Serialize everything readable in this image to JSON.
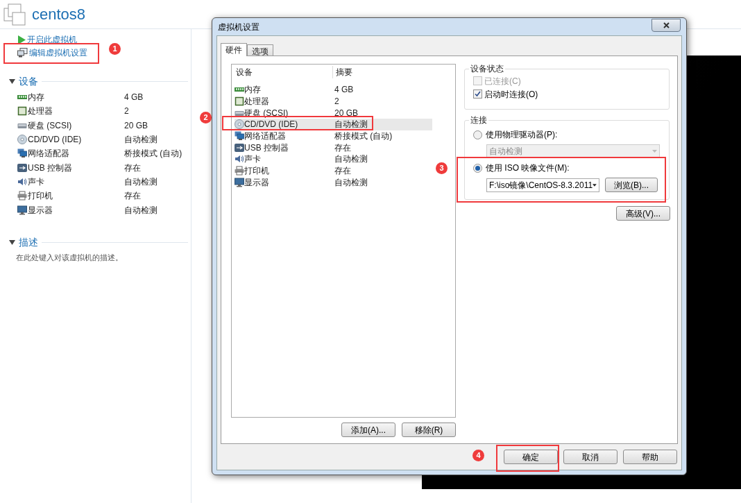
{
  "vm_title": "centos8",
  "actions": [
    {
      "label": "开启此虚拟机",
      "kind": "play"
    },
    {
      "label": "编辑虚拟机设置",
      "kind": "edit"
    }
  ],
  "devices_section": {
    "title": "设备",
    "expanded": true,
    "items": [
      {
        "name": "内存",
        "value": "4 GB",
        "kind": "memory"
      },
      {
        "name": "处理器",
        "value": "2",
        "kind": "cpu"
      },
      {
        "name": "硬盘 (SCSI)",
        "value": "20 GB",
        "kind": "disk"
      },
      {
        "name": "CD/DVD (IDE)",
        "value": "自动检测",
        "kind": "cdrom"
      },
      {
        "name": "网络适配器",
        "value": "桥接模式 (自动)",
        "kind": "network"
      },
      {
        "name": "USB 控制器",
        "value": "存在",
        "kind": "usb"
      },
      {
        "name": "声卡",
        "value": "自动检测",
        "kind": "sound"
      },
      {
        "name": "打印机",
        "value": "存在",
        "kind": "printer"
      },
      {
        "name": "显示器",
        "value": "自动检测",
        "kind": "display"
      }
    ]
  },
  "description_section": {
    "title": "描述",
    "expanded": true,
    "hint": "在此处键入对该虚拟机的描述。"
  },
  "dialog": {
    "title": "虚拟机设置",
    "tabs": [
      {
        "label": "硬件",
        "selected": true
      },
      {
        "label": "选项",
        "selected": false
      }
    ],
    "table": {
      "columns": [
        "设备",
        "摘要"
      ],
      "rows": [
        {
          "device": "内存",
          "summary": "4 GB",
          "kind": "memory",
          "selected": false
        },
        {
          "device": "处理器",
          "summary": "2",
          "kind": "cpu",
          "selected": false
        },
        {
          "device": "硬盘 (SCSI)",
          "summary": "20 GB",
          "kind": "disk",
          "selected": false
        },
        {
          "device": "CD/DVD (IDE)",
          "summary": "自动检测",
          "kind": "cdrom",
          "selected": true
        },
        {
          "device": "网络适配器",
          "summary": "桥接模式 (自动)",
          "kind": "network",
          "selected": false
        },
        {
          "device": "USB 控制器",
          "summary": "存在",
          "kind": "usb",
          "selected": false
        },
        {
          "device": "声卡",
          "summary": "自动检测",
          "kind": "sound",
          "selected": false
        },
        {
          "device": "打印机",
          "summary": "存在",
          "kind": "printer",
          "selected": false
        },
        {
          "device": "显示器",
          "summary": "自动检测",
          "kind": "display",
          "selected": false
        }
      ]
    },
    "list_buttons": [
      "添加(A)...",
      "移除(R)"
    ],
    "device_status": {
      "title": "设备状态",
      "options": [
        {
          "label": "已连接(C)",
          "checked": false,
          "disabled": true
        },
        {
          "label": "启动时连接(O)",
          "checked": true,
          "disabled": false
        }
      ]
    },
    "connection": {
      "title": "连接",
      "options": [
        {
          "label": "使用物理驱动器(P):",
          "selected": false,
          "value": "自动检测",
          "disabled": true
        },
        {
          "label": "使用 ISO 映像文件(M):",
          "selected": true,
          "value": "F:\\iso镜像\\CentOS-8.3.2011",
          "disabled": false
        }
      ],
      "browse_button": "浏览(B)...",
      "advanced_button": "高级(V)..."
    },
    "footer_buttons": [
      "确定",
      "取消",
      "帮助"
    ]
  },
  "annotations": [
    {
      "label": "1"
    },
    {
      "label": "2"
    },
    {
      "label": "3"
    },
    {
      "label": "4"
    }
  ]
}
